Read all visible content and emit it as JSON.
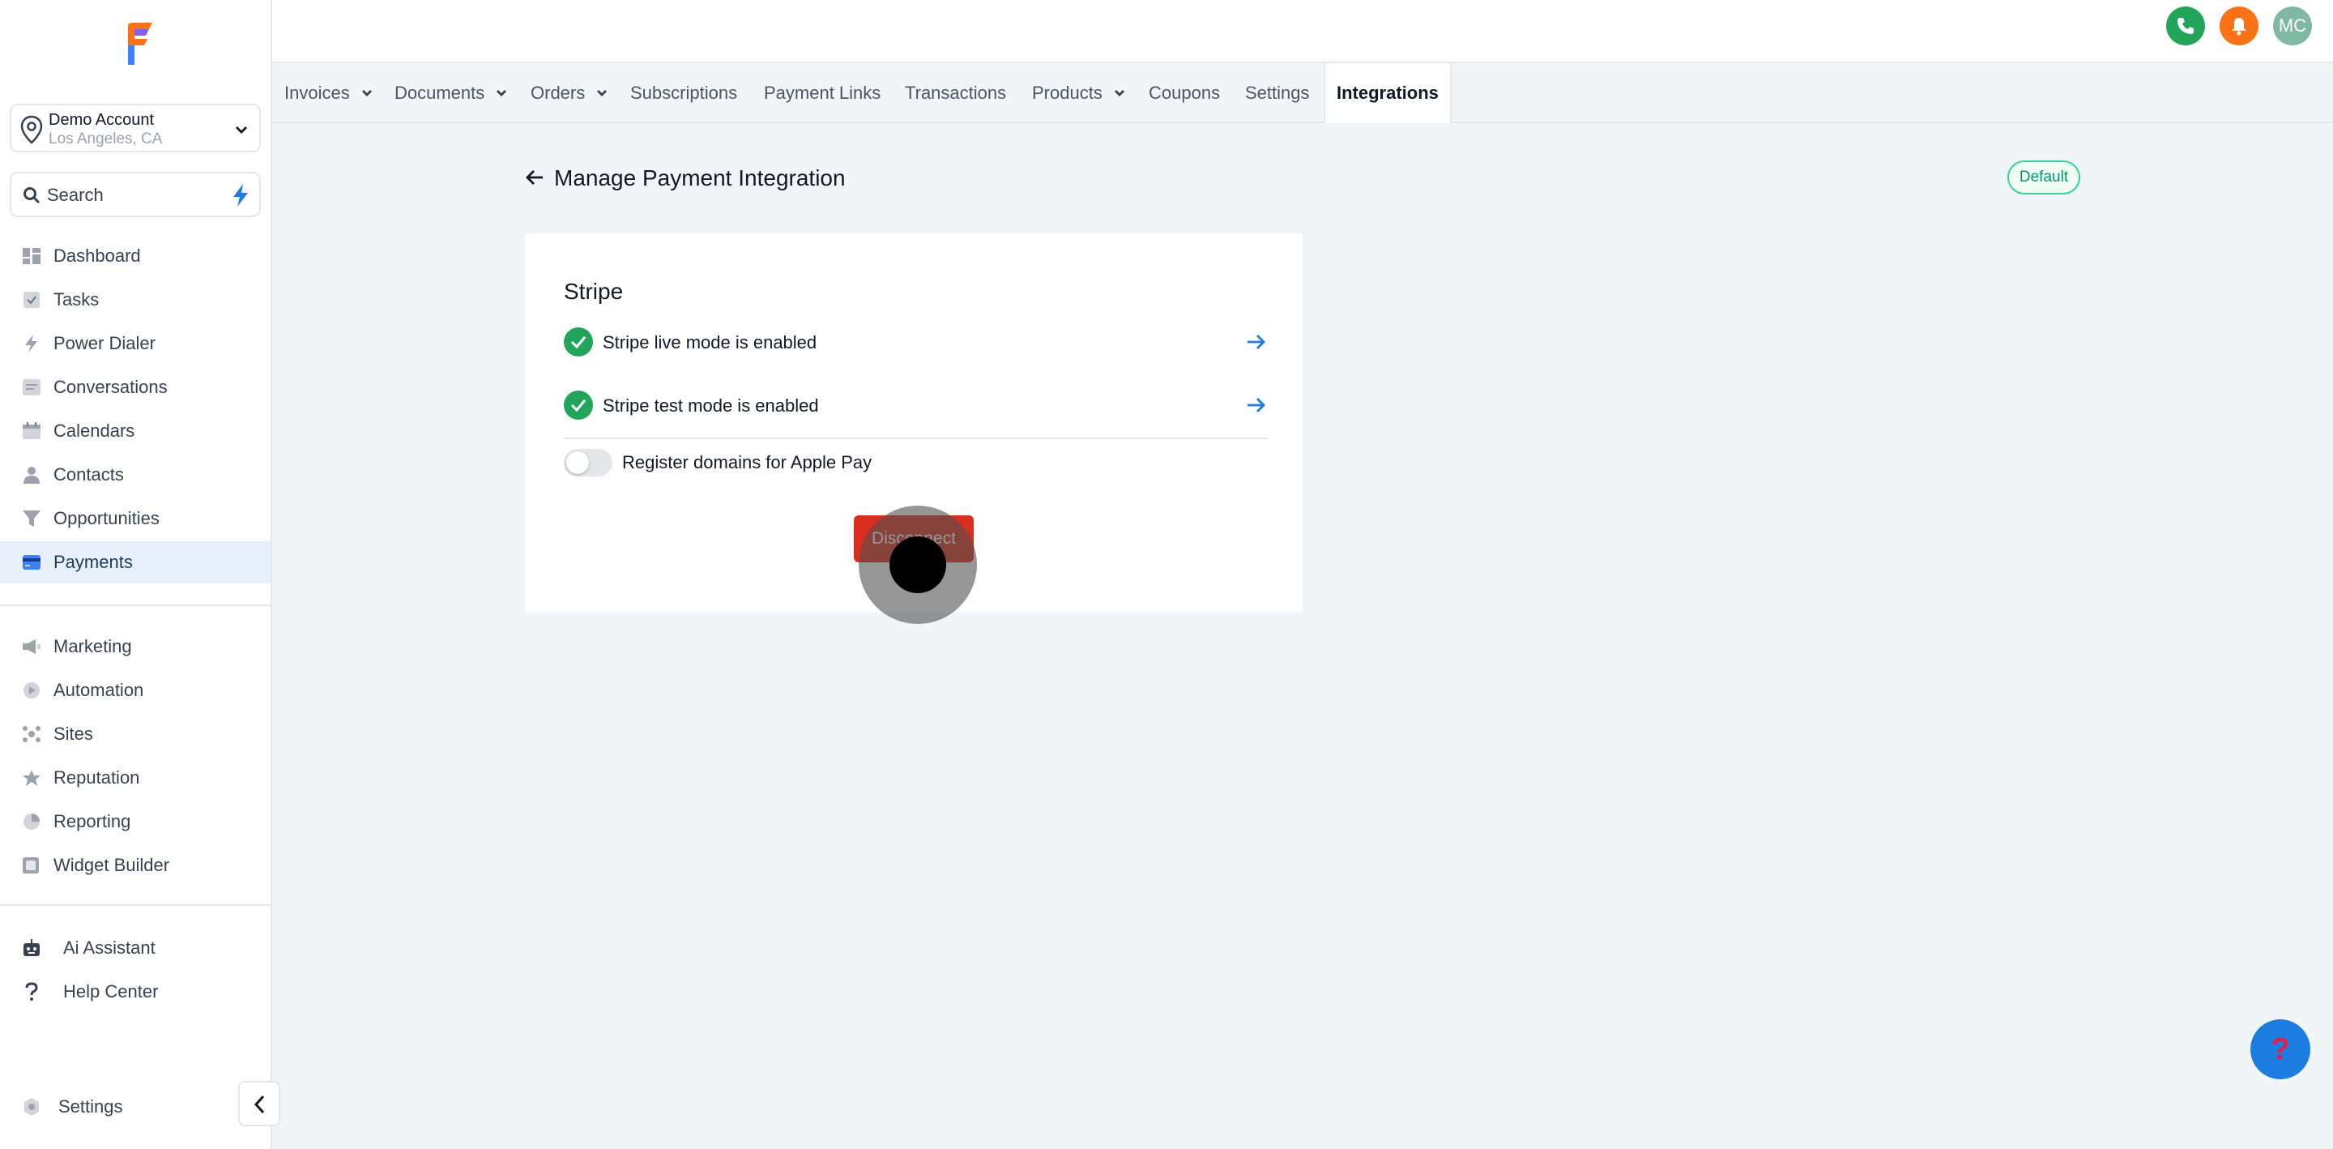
{
  "sidebar": {
    "account": {
      "name": "Demo Account",
      "location": "Los Angeles, CA"
    },
    "search": {
      "placeholder": "Search"
    },
    "items": [
      {
        "label": "Dashboard",
        "icon": "dashboard-icon"
      },
      {
        "label": "Tasks",
        "icon": "tasks-icon"
      },
      {
        "label": "Power Dialer",
        "icon": "power-dialer-icon"
      },
      {
        "label": "Conversations",
        "icon": "conversations-icon"
      },
      {
        "label": "Calendars",
        "icon": "calendar-icon"
      },
      {
        "label": "Contacts",
        "icon": "contacts-icon"
      },
      {
        "label": "Opportunities",
        "icon": "funnel-icon"
      },
      {
        "label": "Payments",
        "icon": "payments-icon",
        "active": true
      },
      {
        "label": "Marketing",
        "icon": "megaphone-icon"
      },
      {
        "label": "Automation",
        "icon": "automation-icon"
      },
      {
        "label": "Sites",
        "icon": "sites-icon"
      },
      {
        "label": "Reputation",
        "icon": "star-icon"
      },
      {
        "label": "Reporting",
        "icon": "pie-chart-icon"
      },
      {
        "label": "Widget Builder",
        "icon": "widget-icon"
      },
      {
        "label": "Ai Assistant",
        "icon": "robot-icon"
      },
      {
        "label": "Help Center",
        "icon": "question-icon"
      },
      {
        "label": "Settings",
        "icon": "gear-icon"
      }
    ]
  },
  "topbar": {
    "avatar_initials": "MC",
    "colors": {
      "phone": "#22a55a",
      "bell": "#f97316",
      "avatar": "#7fb8a3"
    }
  },
  "tabs": [
    {
      "label": "Invoices",
      "dropdown": true
    },
    {
      "label": "Documents",
      "dropdown": true
    },
    {
      "label": "Orders",
      "dropdown": true
    },
    {
      "label": "Subscriptions",
      "dropdown": false
    },
    {
      "label": "Payment Links",
      "dropdown": false
    },
    {
      "label": "Transactions",
      "dropdown": false
    },
    {
      "label": "Products",
      "dropdown": true
    },
    {
      "label": "Coupons",
      "dropdown": false
    },
    {
      "label": "Settings",
      "dropdown": false
    },
    {
      "label": "Integrations",
      "dropdown": false,
      "active": true
    }
  ],
  "main": {
    "title": "Manage Payment Integration",
    "badge": "Default",
    "card": {
      "title": "Stripe",
      "rows": [
        {
          "text": "Stripe live mode is enabled",
          "status": "enabled"
        },
        {
          "text": "Stripe test mode is enabled",
          "status": "enabled"
        }
      ],
      "toggle_label": "Register domains for Apple Pay",
      "toggle_on": false,
      "disconnect_label": "Disconnect"
    }
  },
  "colors": {
    "accent": "#1d7ce0",
    "success": "#22a55a",
    "danger": "#d92d20"
  }
}
